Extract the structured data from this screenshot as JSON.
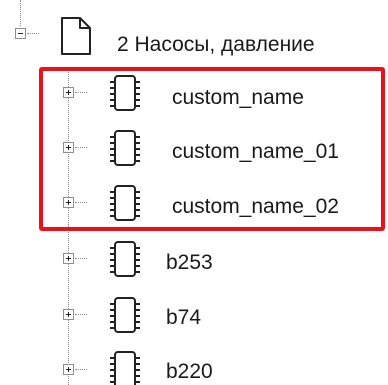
{
  "tree": {
    "root": {
      "label": "2 Насосы, давление",
      "icon": "document-icon",
      "expanded": true
    },
    "children": [
      {
        "label": "custom_name",
        "icon": "chip-icon",
        "expanded": false,
        "highlighted": true
      },
      {
        "label": "custom_name_01",
        "icon": "chip-icon",
        "expanded": false,
        "highlighted": true
      },
      {
        "label": "custom_name_02",
        "icon": "chip-icon",
        "expanded": false,
        "highlighted": true
      },
      {
        "label": "b253",
        "icon": "chip-icon",
        "expanded": false,
        "highlighted": false
      },
      {
        "label": "b74",
        "icon": "chip-icon",
        "expanded": false,
        "highlighted": false
      },
      {
        "label": "b220",
        "icon": "chip-icon",
        "expanded": false,
        "highlighted": false
      }
    ]
  },
  "colors": {
    "highlight_border": "#e8131a",
    "tree_line": "#8c8c8c",
    "text": "#1a1a1a"
  }
}
